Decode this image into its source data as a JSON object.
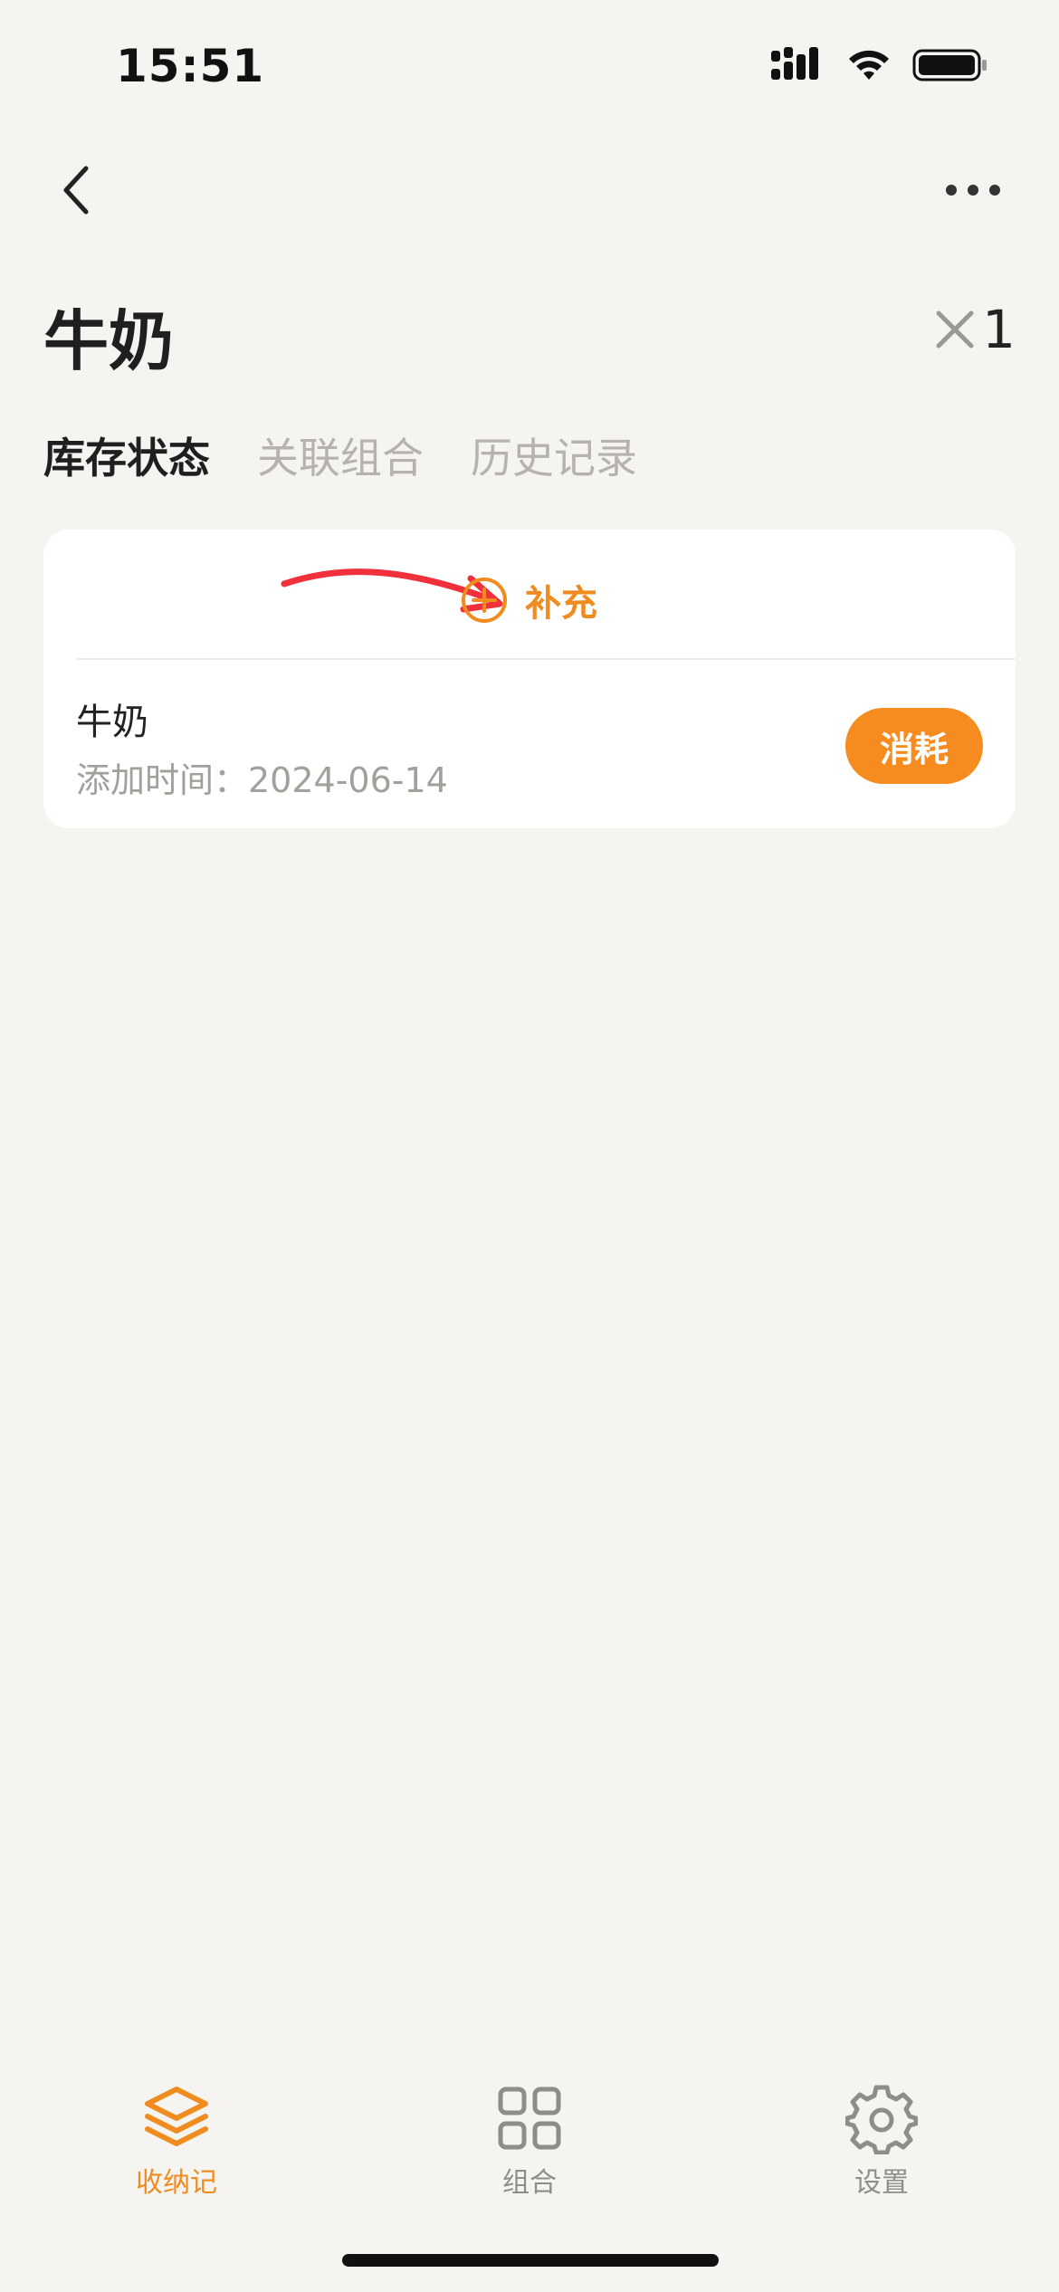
{
  "status_bar": {
    "time": "15:51"
  },
  "header": {
    "back_icon": "chevron-left-icon",
    "more_icon": "ellipsis-icon"
  },
  "item": {
    "title": "牛奶",
    "quantity": "1",
    "quantity_prefix_icon": "multiply-icon"
  },
  "tabs": [
    {
      "label": "库存状态",
      "active": true
    },
    {
      "label": "关联组合",
      "active": false
    },
    {
      "label": "历史记录",
      "active": false
    }
  ],
  "card": {
    "replenish_label": "补充",
    "replenish_icon": "plus-circle-icon",
    "entry": {
      "name": "牛奶",
      "added_time": "添加时间：2024-06-14",
      "consume_label": "消耗"
    }
  },
  "bottom_nav": [
    {
      "label": "收纳记",
      "icon": "stack-icon",
      "active": true
    },
    {
      "label": "组合",
      "icon": "grid-icon",
      "active": false
    },
    {
      "label": "设置",
      "icon": "gear-icon",
      "active": false
    }
  ],
  "colors": {
    "accent": "#F68B1F",
    "annotation_arrow": "#F0303A",
    "background": "#F5F4F1"
  }
}
